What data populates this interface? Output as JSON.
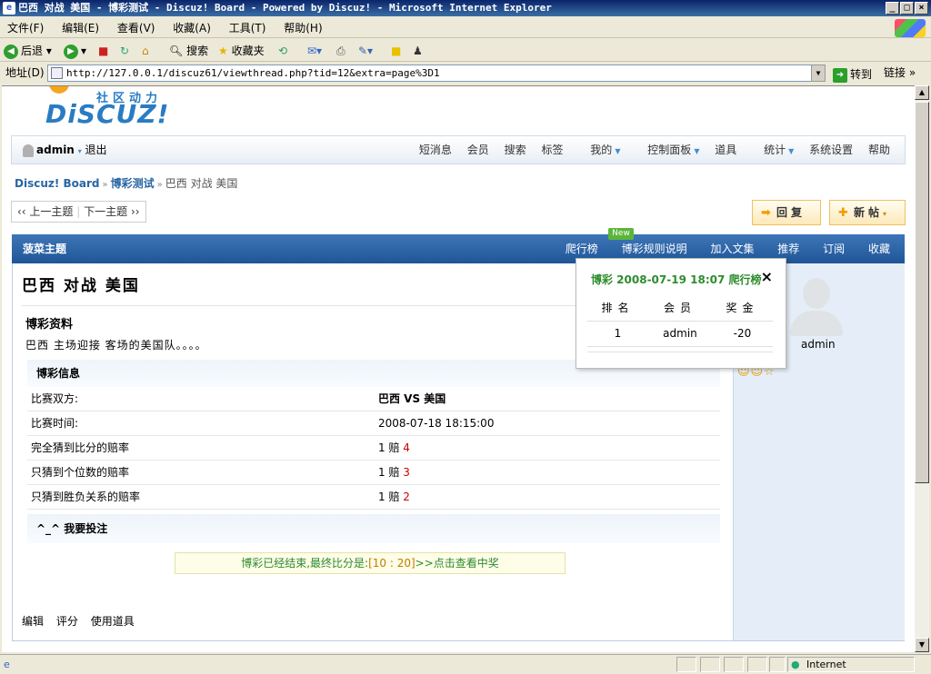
{
  "window": {
    "title": "巴西 对战 美国 - 博彩测试 - Discuz! Board - Powered by Discuz! - Microsoft Internet Explorer"
  },
  "menu": [
    "文件(F)",
    "编辑(E)",
    "查看(V)",
    "收藏(A)",
    "工具(T)",
    "帮助(H)"
  ],
  "toolbar": {
    "back": "后退",
    "search": "搜索",
    "favorites": "收藏夹"
  },
  "address": {
    "label": "地址(D)",
    "url": "http://127.0.0.1/discuz61/viewthread.php?tid=12&extra=page%3D1",
    "go": "转到",
    "links": "链接"
  },
  "status": {
    "zone": "Internet"
  },
  "logo": {
    "cn": "社区动力",
    "en": "DiSCUZ!"
  },
  "nav": {
    "user": "admin",
    "logout": "退出",
    "items": [
      "短消息",
      "会员",
      "搜索",
      "标签",
      "我的",
      "控制面板",
      "道具",
      "统计",
      "系统设置",
      "帮助"
    ]
  },
  "breadcrumb": {
    "board": "Discuz! Board",
    "forum": "博彩测试",
    "thread": "巴西 对战 美国"
  },
  "pager": {
    "prev": "上一主题",
    "next": "下一主题"
  },
  "buttons": {
    "reply": "回复",
    "newpost": "新帖"
  },
  "band": {
    "title": "菠菜主题",
    "badge": "New",
    "actions": [
      "爬行榜",
      "博彩规则说明",
      "加入文集",
      "推荐",
      "订阅",
      "收藏"
    ]
  },
  "post": {
    "title": "巴西 对战 美国",
    "section": "博彩资料",
    "desc": "巴西 主场迎接 客场的美国队。。。。",
    "info_header": "博彩信息",
    "rows": [
      {
        "k": "比赛双方:",
        "v": "巴西 VS 美国",
        "odds": ""
      },
      {
        "k": "比赛时间:",
        "v": "2008-07-18 18:15:00",
        "odds": ""
      },
      {
        "k": "完全猜到比分的赔率",
        "v": "1 赔",
        "odds": "4"
      },
      {
        "k": "只猜到个位数的赔率",
        "v": "1 赔",
        "odds": "3"
      },
      {
        "k": "只猜到胜负关系的赔率",
        "v": "1 赔",
        "odds": "2"
      }
    ],
    "bet": "^_^ 我要投注",
    "ended_prefix": "博彩已经结束,最终比分是:",
    "ended_score": "[10 : 20]",
    "ended_suffix": ">>点击查看中奖",
    "footer": [
      "编辑",
      "评分",
      "使用道具"
    ]
  },
  "author": {
    "name": "admin"
  },
  "popup": {
    "title": "博彩 2008-07-19 18:07 爬行榜",
    "close": "×",
    "headers": [
      "排名",
      "会员",
      "奖金"
    ],
    "rows": [
      {
        "rank": "1",
        "member": "admin",
        "prize": "-20"
      }
    ]
  }
}
